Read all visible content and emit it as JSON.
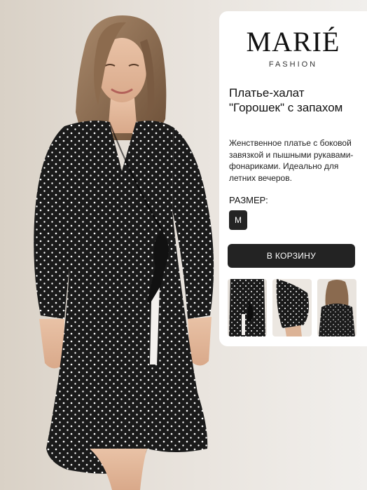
{
  "brand": {
    "name": "MARIÉ",
    "tagline": "FASHION"
  },
  "product": {
    "title": "Платье-халат \"Горошек\" с запахом",
    "description": "Женственное платье с боковой завязкой и пышными рукавами-фонариками. Идеально для летних вечеров.",
    "size_label": "РАЗМЕР:",
    "selected_size": "M",
    "cart_button": "В КОРЗИНУ"
  },
  "colors": {
    "dress": "#1a1a1a",
    "dots": "#ffffff",
    "button": "#232323",
    "card": "#ffffff",
    "background": "#e8e3dd"
  }
}
